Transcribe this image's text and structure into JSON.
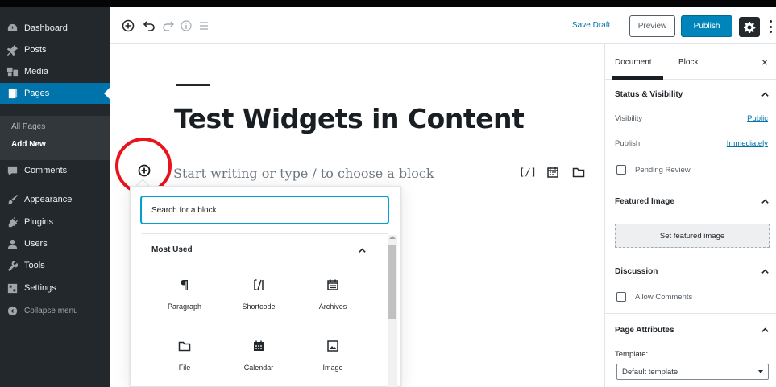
{
  "sidebar": {
    "items": [
      {
        "label": "Dashboard",
        "icon": "dashboard-icon"
      },
      {
        "label": "Posts",
        "icon": "pin-icon"
      },
      {
        "label": "Media",
        "icon": "media-icon"
      },
      {
        "label": "Pages",
        "icon": "page-icon"
      },
      {
        "label": "Comments",
        "icon": "comment-icon"
      },
      {
        "label": "Appearance",
        "icon": "brush-icon"
      },
      {
        "label": "Plugins",
        "icon": "plug-icon"
      },
      {
        "label": "Users",
        "icon": "user-icon"
      },
      {
        "label": "Tools",
        "icon": "wrench-icon"
      },
      {
        "label": "Settings",
        "icon": "settings-icon"
      },
      {
        "label": "Collapse menu",
        "icon": "collapse-icon"
      }
    ],
    "submenu": [
      "All Pages",
      "Add New"
    ],
    "accent": "#0073aa"
  },
  "toolbar": {
    "save_draft": "Save Draft",
    "preview": "Preview",
    "publish": "Publish"
  },
  "editor": {
    "title": "Test Widgets in Content",
    "placeholder": "Start writing or type / to choose a block",
    "shortcode_icon_text": "[/]"
  },
  "inserter": {
    "search_placeholder": "Search for a block",
    "section_title": "Most Used",
    "blocks": [
      {
        "label": "Paragraph",
        "icon": "paragraph-icon"
      },
      {
        "label": "Shortcode",
        "icon": "shortcode-icon"
      },
      {
        "label": "Archives",
        "icon": "archives-icon"
      },
      {
        "label": "File",
        "icon": "folder-icon"
      },
      {
        "label": "Calendar",
        "icon": "calendar-icon"
      },
      {
        "label": "Image",
        "icon": "image-icon"
      }
    ]
  },
  "settings": {
    "tabs": [
      "Document",
      "Block"
    ],
    "close": "×",
    "status": {
      "title": "Status & Visibility",
      "visibility_label": "Visibility",
      "visibility_value": "Public",
      "publish_label": "Publish",
      "publish_value": "Immediately",
      "pending_review": "Pending Review"
    },
    "featured": {
      "title": "Featured Image",
      "button": "Set featured image"
    },
    "discussion": {
      "title": "Discussion",
      "allow_comments": "Allow Comments"
    },
    "attributes": {
      "title": "Page Attributes",
      "template_label": "Template:",
      "template_value": "Default template"
    }
  },
  "annotation_color": "#e8131b"
}
